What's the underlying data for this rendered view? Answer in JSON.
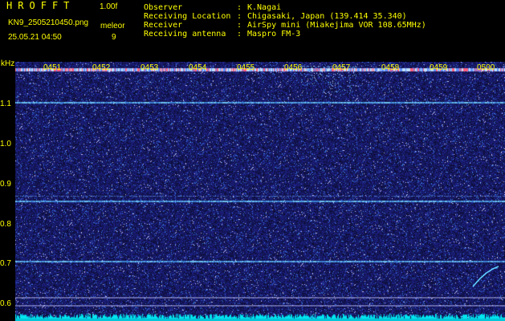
{
  "header": {
    "brand_letters": [
      "H",
      "R",
      "O",
      "F",
      "F",
      "T"
    ],
    "version": "1.00f",
    "filename": "KN9_2505210450.png",
    "mode_label": "meleor",
    "datetime": "25.05.21 04:50",
    "count": "9"
  },
  "info": {
    "rows": [
      {
        "key": "Observer",
        "value": "K.Nagai"
      },
      {
        "key": "Receiving Location",
        "value": "Chigasaki, Japan (139.414 35.340)"
      },
      {
        "key": "Receiver",
        "value": "AirSpy mini (Miakejima VOR 108.65MHz)"
      },
      {
        "key": "Receiving antenna",
        "value": "Maspro FM-3"
      }
    ]
  },
  "axis": {
    "unit": "kHz",
    "y_ticks": [
      "1.1",
      "1.0",
      "0.9",
      "0.8",
      "0.7",
      "0.6"
    ],
    "time_ticks": [
      "0451",
      "0452",
      "0453",
      "0454",
      "0455",
      "0456",
      "0457",
      "0458",
      "0459",
      "0500"
    ]
  },
  "colors": {
    "background": "#000000",
    "label": "#ffff00",
    "noise": "#1a1a8c",
    "carrier": "#4aa6e6",
    "bottom_strip": "#00e6f0",
    "meteor_echo": "#60d0ff"
  }
}
